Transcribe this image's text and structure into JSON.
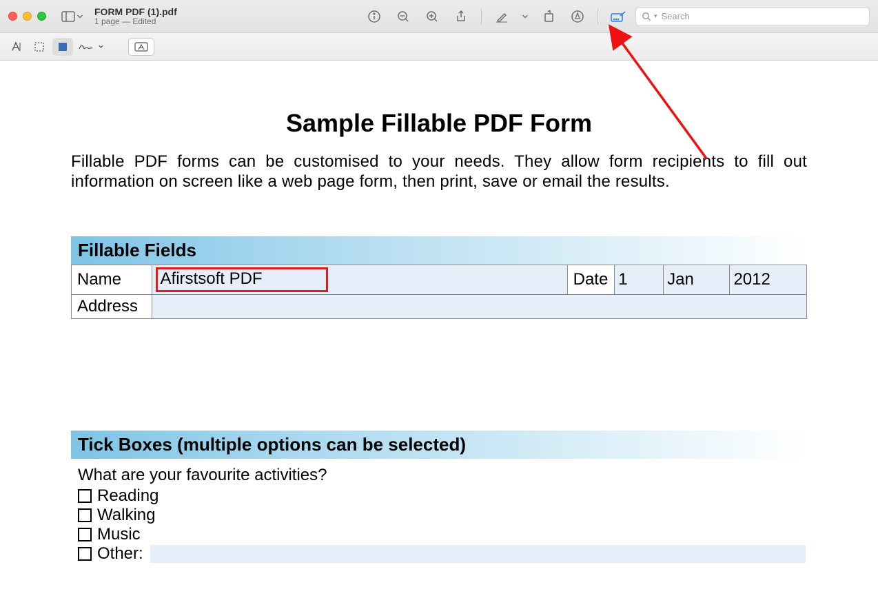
{
  "window": {
    "filename": "FORM PDF (1).pdf",
    "subtitle": "1 page — Edited"
  },
  "toolbar": {
    "search_placeholder": "Search"
  },
  "document": {
    "title": "Sample Fillable PDF Form",
    "intro": "Fillable PDF forms can be customised to your needs. They allow form recipients to fill out information on screen like a web page form, then print, save or email the results.",
    "fields_section_title": "Fillable Fields",
    "name_label": "Name",
    "name_value": "Afirstsoft PDF",
    "date_label": "Date",
    "date_day": "1",
    "date_month": "Jan",
    "date_year": "2012",
    "address_label": "Address",
    "tick_section_title": "Tick Boxes (multiple options can be selected)",
    "tick_question": "What are your favourite activities?",
    "options": {
      "reading": "Reading",
      "walking": "Walking",
      "music": "Music",
      "other": "Other:"
    }
  }
}
